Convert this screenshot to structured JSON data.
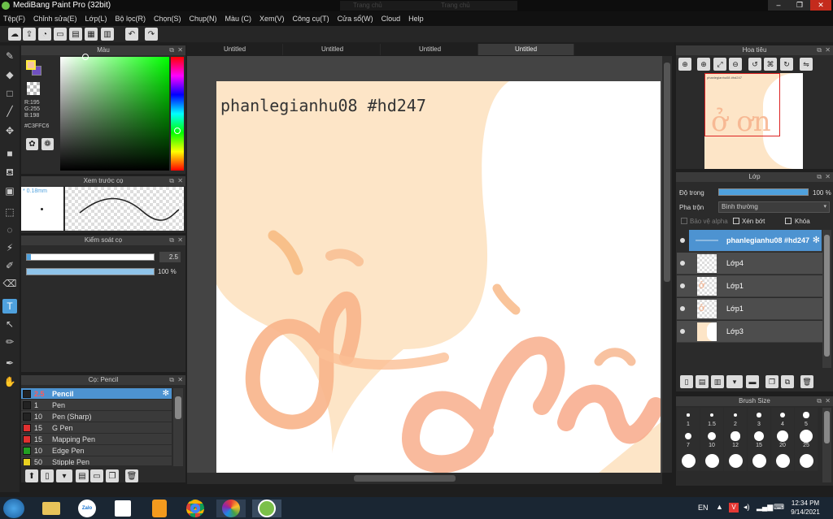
{
  "window": {
    "title": "MediBang Paint Pro (32bit)",
    "bg_tabs": [
      "Trang chủ",
      "Trang chủ"
    ],
    "controls": [
      "–",
      "❐",
      "✕"
    ]
  },
  "menu": [
    "Tệp(F)",
    "Chỉnh sửa(E)",
    "Lớp(L)",
    "Bộ lọc(R)",
    "Chọn(S)",
    "Chụp(N)",
    "Màu (C)",
    "Xem(V)",
    "Công cụ(T)",
    "Cửa sổ(W)",
    "Cloud",
    "Help"
  ],
  "color_panel": {
    "title": "Màu",
    "r": "R:195",
    "g": "G:255",
    "b": "B:198",
    "hex": "#C3FFC6",
    "main_color": "#f5c4a0"
  },
  "brush_preview": {
    "title": "Xem trước cọ",
    "size": "0.18mm"
  },
  "brush_control": {
    "title": "Kiểm soát cọ",
    "size_value": "2.5",
    "opacity_value": "100 %",
    "size_fraction": 0.03,
    "opacity_fraction": 1.0
  },
  "brush_list": {
    "title": "Cọ: Pencil",
    "items": [
      {
        "size": "2.5",
        "name": "Pencil",
        "color": "#222222"
      },
      {
        "size": "1",
        "name": "Pen",
        "color": "#222222"
      },
      {
        "size": "10",
        "name": "Pen (Sharp)",
        "color": "#222222"
      },
      {
        "size": "15",
        "name": "G Pen",
        "color": "#e03030"
      },
      {
        "size": "15",
        "name": "Mapping Pen",
        "color": "#e03030"
      },
      {
        "size": "10",
        "name": "Edge Pen",
        "color": "#22a022"
      },
      {
        "size": "50",
        "name": "Stipple Pen",
        "color": "#e8d020"
      }
    ]
  },
  "doc_tabs": [
    "Untitled",
    "Untitled",
    "Untitled",
    "Untitled"
  ],
  "canvas": {
    "text": "phanlegianhu08 #hd247"
  },
  "navigator": {
    "title": "Hoa tiêu",
    "thumb_text": "phanlegianhu08 #hd247"
  },
  "layer_panel": {
    "title": "Lớp",
    "opacity_label": "Độ trong",
    "opacity_value": "100 %",
    "opacity_fraction": 1.0,
    "blend_label": "Pha trộn",
    "blend_value": "Bình thường",
    "chk_alpha": "Bảo vệ alpha",
    "chk_clip": "Xén bớt",
    "chk_lock": "Khóa",
    "layers": [
      "phanlegianhu08 #hd247",
      "Lớp4",
      "Lớp1",
      "Lớp1",
      "Lớp3"
    ]
  },
  "brush_size": {
    "title": "Brush Size",
    "labels": [
      "1",
      "1.5",
      "2",
      "3",
      "4",
      "5",
      "7",
      "10",
      "12",
      "15",
      "20",
      "25"
    ]
  },
  "taskbar": {
    "lang": "EN",
    "time": "12:34 PM",
    "date": "9/14/2021"
  }
}
